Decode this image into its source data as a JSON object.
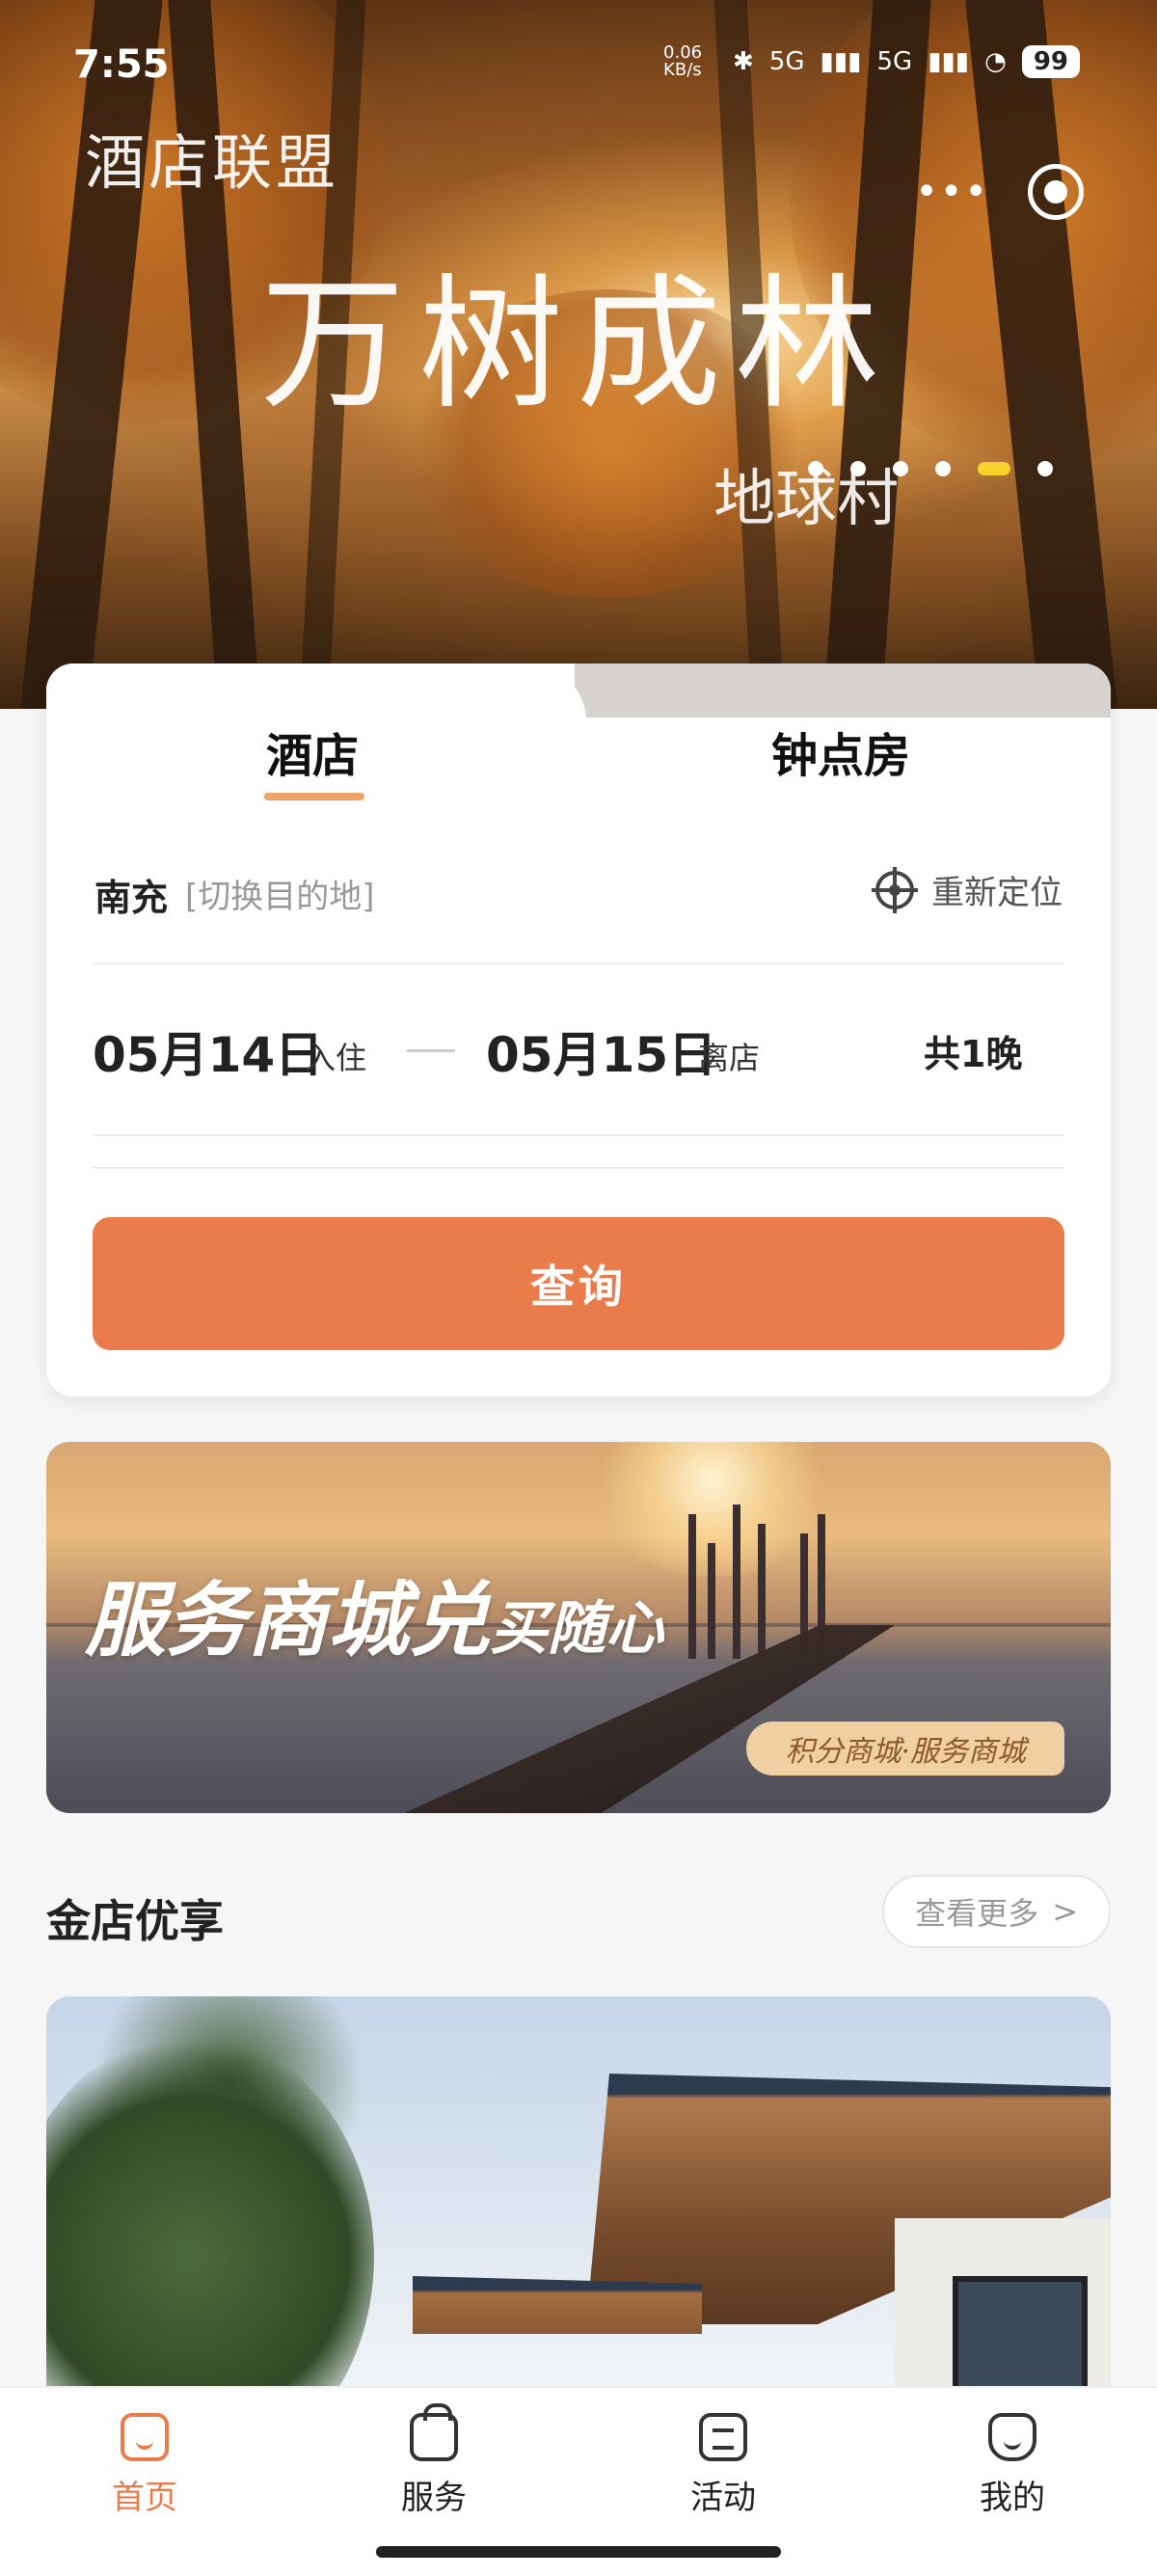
{
  "status_bar": {
    "time": "7:55",
    "net_speed": "0.06 KB/s",
    "signal_1": "5G",
    "signal_2": "5G",
    "battery": "99"
  },
  "hero": {
    "brand": "酒店联盟",
    "title": "万树成林",
    "subtitle": "地球村",
    "carousel_count": 6,
    "carousel_active_index": 4
  },
  "booking": {
    "tabs": [
      {
        "label": "酒店",
        "active": true
      },
      {
        "label": "钟点房",
        "active": false
      }
    ],
    "city": "南充",
    "switch_destination": "[切换目的地]",
    "relocate": "重新定位",
    "check_in_date": "05月14日",
    "check_in_label": "入住",
    "check_out_date": "05月15日",
    "check_out_label": "离店",
    "nights": "共1晚",
    "search_label": "查询"
  },
  "promo": {
    "title_main": "服务商城兑",
    "title_small": "买随心",
    "tag": "积分商城·服务商城"
  },
  "section": {
    "title": "金店优享",
    "see_more": "查看更多",
    "see_more_arrow": ">"
  },
  "bottom_nav": [
    {
      "label": "首页",
      "icon": "home-icon",
      "active": true
    },
    {
      "label": "服务",
      "icon": "bag-icon",
      "active": false
    },
    {
      "label": "活动",
      "icon": "list-icon",
      "active": false
    },
    {
      "label": "我的",
      "icon": "profile-icon",
      "active": false
    }
  ],
  "colors": {
    "accent": "#ea7c4c",
    "tab_underline": "#f0a368",
    "carousel_active": "#f5d22e"
  }
}
